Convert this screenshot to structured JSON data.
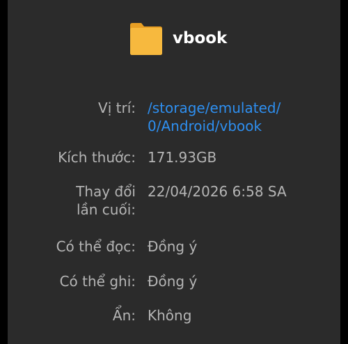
{
  "header": {
    "icon": "folder-icon",
    "icon_color": "#f7b93e",
    "name": "vbook"
  },
  "details": {
    "location_label": "Vị trí:",
    "location_line1": "/storage/emulated/",
    "location_line2": "0/Android/vbook",
    "size_label": "Kích thước:",
    "size_value": "171.93GB",
    "modified_label_line1": "Thay đổi",
    "modified_label_line2": "lần cuối:",
    "modified_value": "22/04/2026 6:58 SA",
    "readable_label": "Có thể đọc:",
    "readable_value": "Đồng ý",
    "writable_label": "Có thể ghi:",
    "writable_value": "Đồng ý",
    "hidden_label": "Ẩn:",
    "hidden_value": "Không"
  },
  "colors": {
    "background": "#2b2b2b",
    "link": "#2e8ff0",
    "text": "#b5b5b5"
  }
}
